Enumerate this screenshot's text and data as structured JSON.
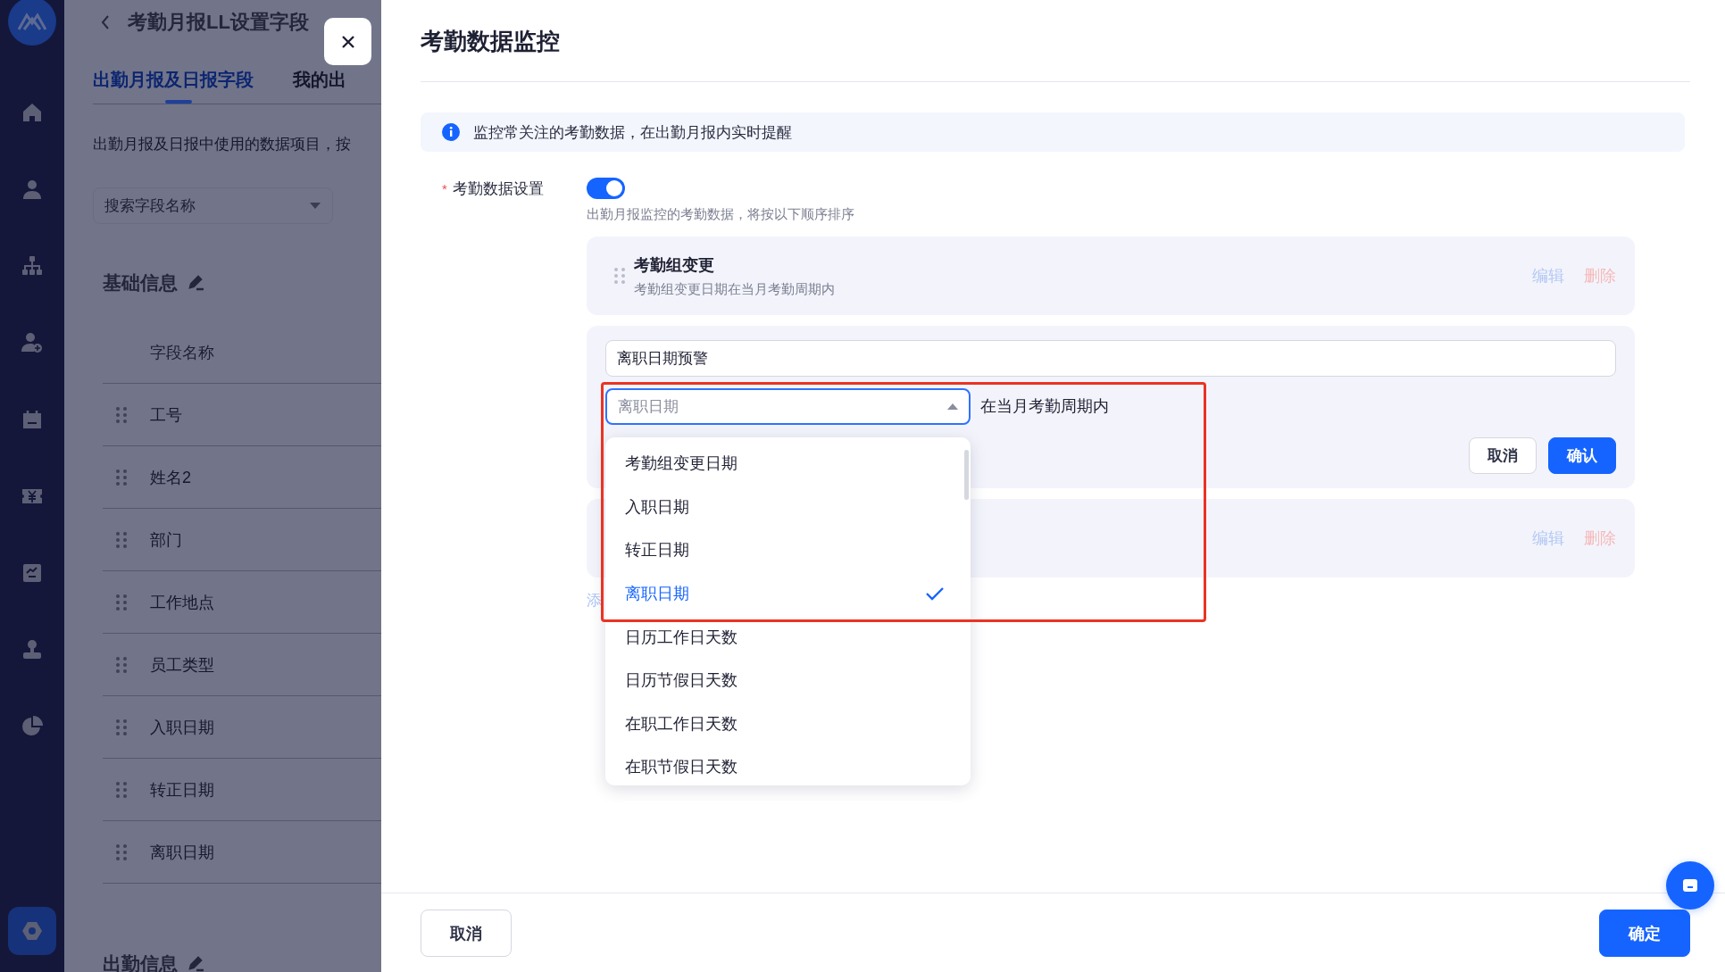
{
  "nav": {
    "items": [
      {
        "kind": "home",
        "selected": false
      },
      {
        "kind": "person",
        "selected": false
      },
      {
        "kind": "org",
        "selected": false
      },
      {
        "kind": "person-add",
        "selected": false
      },
      {
        "kind": "calendar",
        "selected": false
      },
      {
        "kind": "money",
        "selected": false
      },
      {
        "kind": "report",
        "selected": false
      },
      {
        "kind": "stamp",
        "selected": false
      },
      {
        "kind": "pie",
        "selected": false
      },
      {
        "kind": "settings",
        "selected": true
      }
    ]
  },
  "page": {
    "title": "考勤月报LL设置字段",
    "tabs": [
      {
        "label": "出勤月报及日报字段",
        "selected": true
      },
      {
        "label": "我的出",
        "selected": false
      }
    ],
    "description": "出勤月报及日报中使用的数据项目，按",
    "search": {
      "placeholder": "搜索字段名称"
    },
    "sections": [
      {
        "title": "基础信息",
        "column": "字段名称",
        "rows": [
          "工号",
          "姓名2",
          "部门",
          "工作地点",
          "员工类型",
          "入职日期",
          "转正日期",
          "离职日期"
        ]
      },
      {
        "title": "出勤信息"
      }
    ]
  },
  "drawer": {
    "title": "考勤数据监控",
    "notice": "监控常关注的考勤数据，在出勤月报内实时提醒",
    "setting": {
      "required_mark": "*",
      "label": "考勤数据设置",
      "on": true,
      "hint": "出勤月报监控的考勤数据，将按以下顺序排序"
    },
    "rules": [
      {
        "kind": "item",
        "title": "考勤组变更",
        "detail": "考勤组变更日期在当月考勤周期内",
        "actions": [
          {
            "kind": "edit",
            "label": "编辑",
            "disabled": true
          },
          {
            "kind": "delete",
            "label": "删除",
            "disabled": true
          }
        ]
      },
      {
        "kind": "editing",
        "name": "离职日期预警",
        "field": {
          "placeholder": "离职日期",
          "expanded": true
        },
        "condition": "在当月考勤周期内",
        "buttons": [
          {
            "kind": "secondary",
            "label": "取消"
          },
          {
            "kind": "primary",
            "label": "确认"
          }
        ]
      },
      {
        "kind": "item",
        "actions": [
          {
            "kind": "edit",
            "label": "编辑",
            "disabled": true
          },
          {
            "kind": "delete",
            "label": "删除",
            "disabled": true
          }
        ]
      }
    ],
    "add_link": "添",
    "dropdown": {
      "options": [
        {
          "label": "考勤组变更日期",
          "selected": false
        },
        {
          "label": "入职日期",
          "selected": false
        },
        {
          "label": "转正日期",
          "selected": false
        },
        {
          "label": "离职日期",
          "selected": true
        },
        {
          "label": "日历工作日天数",
          "selected": false
        },
        {
          "label": "日历节假日天数",
          "selected": false
        },
        {
          "label": "在职工作日天数",
          "selected": false
        },
        {
          "label": "在职节假日天数",
          "selected": false
        }
      ]
    },
    "footer": {
      "cancel": "取消",
      "confirm": "确定"
    }
  }
}
